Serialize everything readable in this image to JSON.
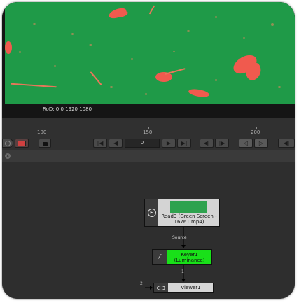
{
  "viewer": {
    "rod_text": "RoD: 0 0 1920 1080"
  },
  "timeline": {
    "ticks": [
      "100",
      "150",
      "200"
    ],
    "current_frame": "0"
  },
  "node_graph": {
    "read_node": {
      "label": "Read3 (Green Screen - 16761.mp4)"
    },
    "keyer_node": {
      "label": "Keyer1 (Luminance)"
    },
    "viewer_node": {
      "label": "Viewer1"
    },
    "source_label": "Source",
    "input_one": "1",
    "input_two": "2"
  },
  "colors": {
    "plate_green": "#1f9a48",
    "keyer_green": "#19e019",
    "panel_bg": "#2e2e2e"
  }
}
